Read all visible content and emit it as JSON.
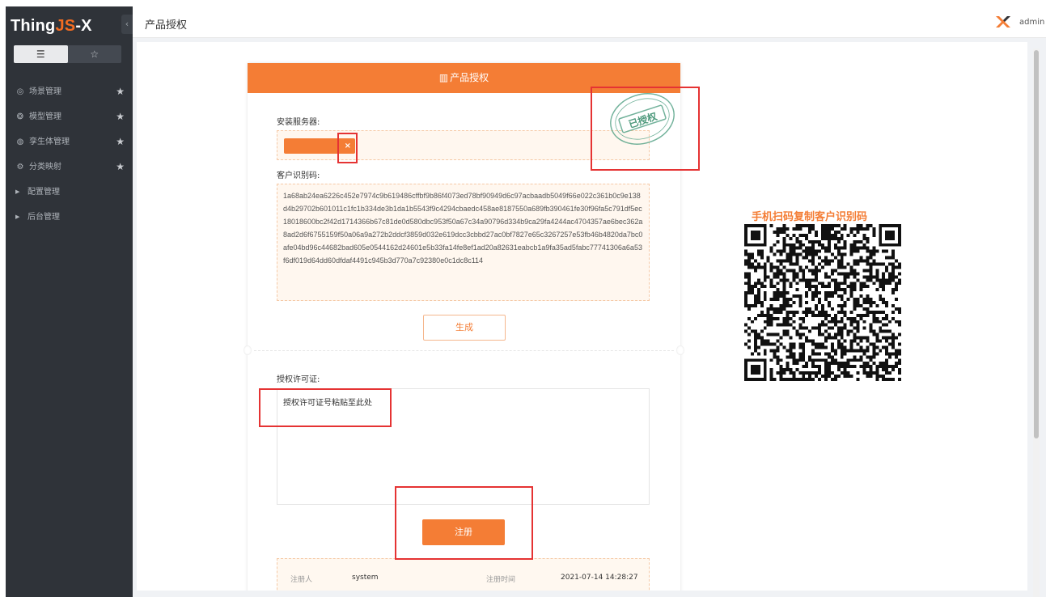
{
  "sidebar": {
    "logo_prefix": "Thing",
    "logo_js": "JS",
    "logo_suffix": "-X",
    "collapse_glyph": "‹",
    "view_list_glyph": "☰",
    "view_fav_glyph": "☆",
    "items": [
      {
        "label": "场景管理",
        "icon": "layers-icon",
        "glyph": "◎",
        "starred": true
      },
      {
        "label": "模型管理",
        "icon": "cube-icon",
        "glyph": "❂",
        "starred": true
      },
      {
        "label": "孪生体管理",
        "icon": "globe-icon",
        "glyph": "◍",
        "starred": true
      },
      {
        "label": "分类映射",
        "icon": "mapping-icon",
        "glyph": "⚙",
        "starred": true
      },
      {
        "label": "配置管理",
        "icon": "caret-right-icon",
        "glyph": "▶",
        "starred": false
      },
      {
        "label": "后台管理",
        "icon": "caret-right-icon",
        "glyph": "▶",
        "starred": false
      }
    ],
    "star_glyph": "★"
  },
  "header": {
    "title": "产品授权",
    "username": "admin"
  },
  "card": {
    "title": "产品授权",
    "server_label": "安装服务器:",
    "server_tag_remove": "×",
    "code_label": "客户识别码:",
    "customer_code": "1a68ab24ea6226c452e7974c9b619486cffbf9b86f4073ed78bf90949d6c97acbaadb5049f66e022c361b0c9e138d4b29702b601011c1fc1b334de3b1da1b5543f9c4294cbaedc458ae8187550a689fb390461fe30f96fa5c791df5ec18018600bc2f42d1714366b67c81de0d580dbc953f50a67c34a90796d334b9ca29fa4244ac4704357ae6bec362a8ad2d6f6755159f50a06a9a272b2ddcf3859d032e619dcc3cbbd27ac0bf7827e65c3267257e53fb46b4820da7bc0afe04bd96c44682bad605e0544162d24601e5b33fa14fe8ef1ad20a82631eabcb1a9fa35ad5fabc77741306a6a53f6df019d64dd60dfdaf4491c945b3d770a7c92380e0c1dc8c114",
    "generate_label": "生成",
    "license_label": "授权许可证:",
    "license_placeholder": "授权许可证号粘贴至此处",
    "register_label": "注册",
    "registrant_label": "注册人",
    "registrant_value": "system",
    "reg_time_label": "注册时间",
    "reg_time_value": "2021-07-14 14:28:27",
    "stamp_text": "已授权"
  },
  "qr": {
    "title": "手机扫码复制客户识别码"
  },
  "colors": {
    "accent": "#f47d35",
    "sidebar_bg": "#2f3339",
    "annotation": "#e53333"
  }
}
